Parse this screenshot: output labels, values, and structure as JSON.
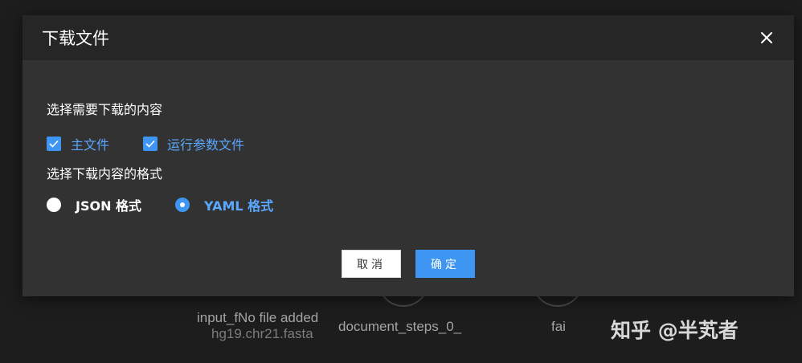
{
  "background": {
    "nodes": [
      {
        "label": "input_fNo file added",
        "sublabel": "hg19.chr21.fasta"
      },
      {
        "label": "document_steps_0_",
        "sublabel": ""
      },
      {
        "label": "fai",
        "sublabel": ""
      }
    ],
    "watermark": "知乎 @半芄者"
  },
  "dialog": {
    "title": "下载文件",
    "close_icon": "close-icon",
    "content_section": {
      "title": "选择需要下载的内容",
      "options": [
        {
          "label": "主文件",
          "checked": true
        },
        {
          "label": "运行参数文件",
          "checked": true
        }
      ]
    },
    "format_section": {
      "title": "选择下载内容的格式",
      "options": [
        {
          "label": "JSON 格式",
          "selected": false
        },
        {
          "label": "YAML 格式",
          "selected": true
        }
      ]
    },
    "cancel_label": "取消",
    "ok_label": "确定"
  },
  "colors": {
    "accent": "#3e96f2",
    "accent_text": "#5aa8ff",
    "dialog_bg": "#323232",
    "header_bg": "#262626",
    "page_bg": "#1d1d1d"
  }
}
